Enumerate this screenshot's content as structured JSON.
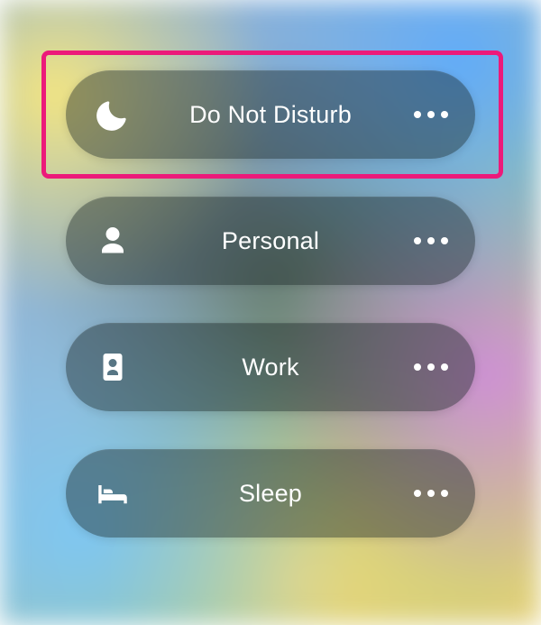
{
  "focus_modes": [
    {
      "id": "do-not-disturb",
      "label": "Do Not Disturb",
      "icon": "moon",
      "highlighted": true
    },
    {
      "id": "personal",
      "label": "Personal",
      "icon": "person",
      "highlighted": false
    },
    {
      "id": "work",
      "label": "Work",
      "icon": "badge",
      "highlighted": false
    },
    {
      "id": "sleep",
      "label": "Sleep",
      "icon": "bed",
      "highlighted": false
    }
  ],
  "highlight_color": "#ec1a7a"
}
